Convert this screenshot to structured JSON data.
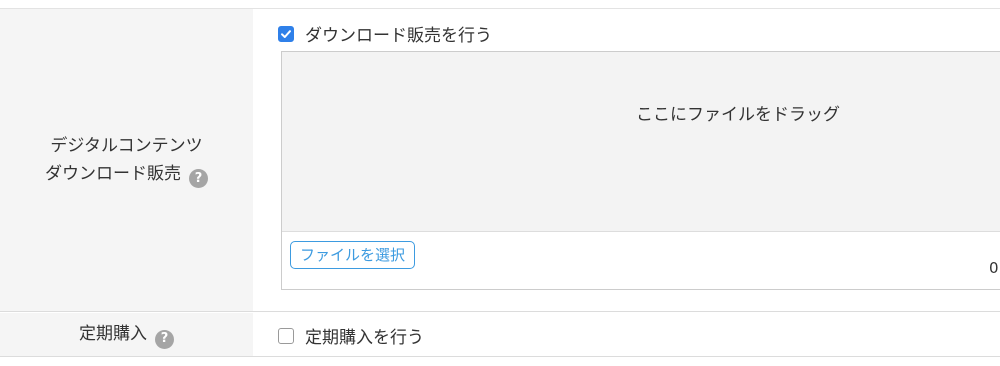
{
  "download_sale": {
    "label_line1": "デジタルコンテンツ",
    "label_line2": "ダウンロード販売",
    "checkbox_label": "ダウンロード販売を行う",
    "checked": true,
    "dropzone_text": "ここにファイルをドラッグ",
    "file_button_label": "ファイルを選択",
    "file_count": "0",
    "help_icon": "question-circle-icon"
  },
  "subscription": {
    "label": "定期購入",
    "checkbox_label": "定期購入を行う",
    "checked": false,
    "help_icon": "question-circle-icon"
  },
  "colors": {
    "accent": "#2f80e9",
    "button_border": "#3d9be0",
    "label_bg": "#f5f5f5",
    "help_icon_bg": "#a5a5a5"
  }
}
